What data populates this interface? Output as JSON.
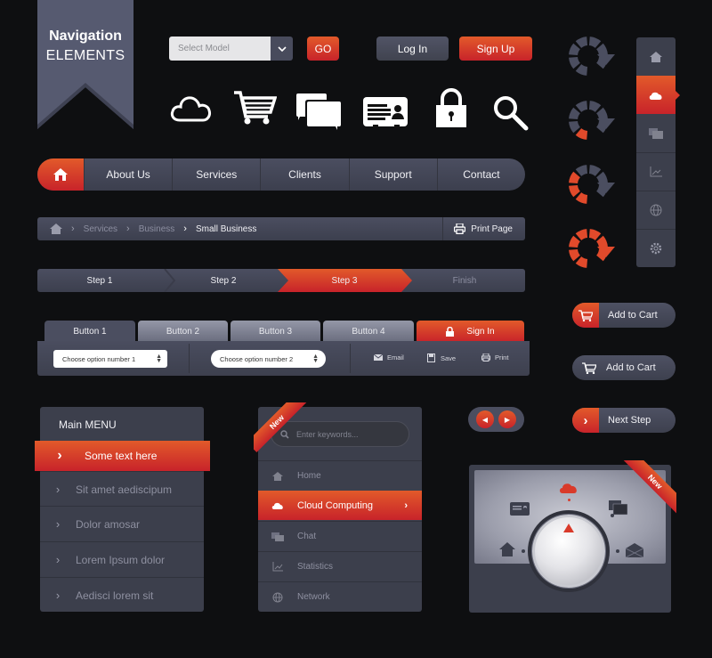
{
  "ribbon": {
    "line1": "Navigation",
    "line2": "ELEMENTS"
  },
  "top_controls": {
    "select_model": {
      "value": "Select Model",
      "icon": "chevron-down-icon"
    },
    "go_label": "GO",
    "login_label": "Log In",
    "signup_label": "Sign Up"
  },
  "icons": [
    "cloud-icon",
    "shopping-cart-icon",
    "chat-icon",
    "id-card-icon",
    "lock-icon",
    "search-icon"
  ],
  "main_nav": {
    "home_icon": "home-icon",
    "items": [
      "About Us",
      "Services",
      "Clients",
      "Support",
      "Contact"
    ]
  },
  "breadcrumb": {
    "items": [
      "Services",
      "Business",
      "Small Business"
    ],
    "print_label": "Print Page"
  },
  "steps": {
    "items": [
      "Step 1",
      "Step 2",
      "Step 3",
      "Finish"
    ],
    "active_index": 2
  },
  "tabs": {
    "items": [
      "Button 1",
      "Button 2",
      "Button 3",
      "Button 4"
    ],
    "sign_in_label": "Sign In",
    "option1": "Choose option number 1",
    "option2": "Choose option number 2",
    "actions": [
      "Email",
      "Save",
      "Print"
    ]
  },
  "main_menu": {
    "header": "Main  MENU",
    "active": "Some text here",
    "items": [
      "Sit amet aediscipum",
      "Dolor amosar",
      "Lorem Ipsum dolor",
      "Aedisci lorem sit"
    ]
  },
  "search_menu": {
    "badge": "New",
    "placeholder": "Enter keywords...",
    "items": [
      "Home",
      "Cloud Computing",
      "Chat",
      "Statistics",
      "Network"
    ],
    "active_index": 1
  },
  "loaders": {
    "progress_segments_of_8": [
      0,
      1,
      3,
      8
    ]
  },
  "vertical_nav": {
    "items": [
      "home-icon",
      "cloud-icon",
      "chat-icon",
      "chart-icon",
      "globe-icon",
      "gear-icon"
    ],
    "active_index": 1
  },
  "buttons": {
    "add_to_cart_1": "Add to Cart",
    "add_to_cart_2": "Add to Cart",
    "next_step": "Next Step"
  },
  "dial": {
    "badge": "New",
    "icons": [
      "home-icon",
      "id-card-icon",
      "cloud-icon",
      "chat-icon",
      "mail-icon"
    ],
    "selected": "cloud-icon"
  },
  "colors": {
    "accent": "#d93a2a",
    "panel": "#4b4e60",
    "background": "#0e0f11"
  }
}
